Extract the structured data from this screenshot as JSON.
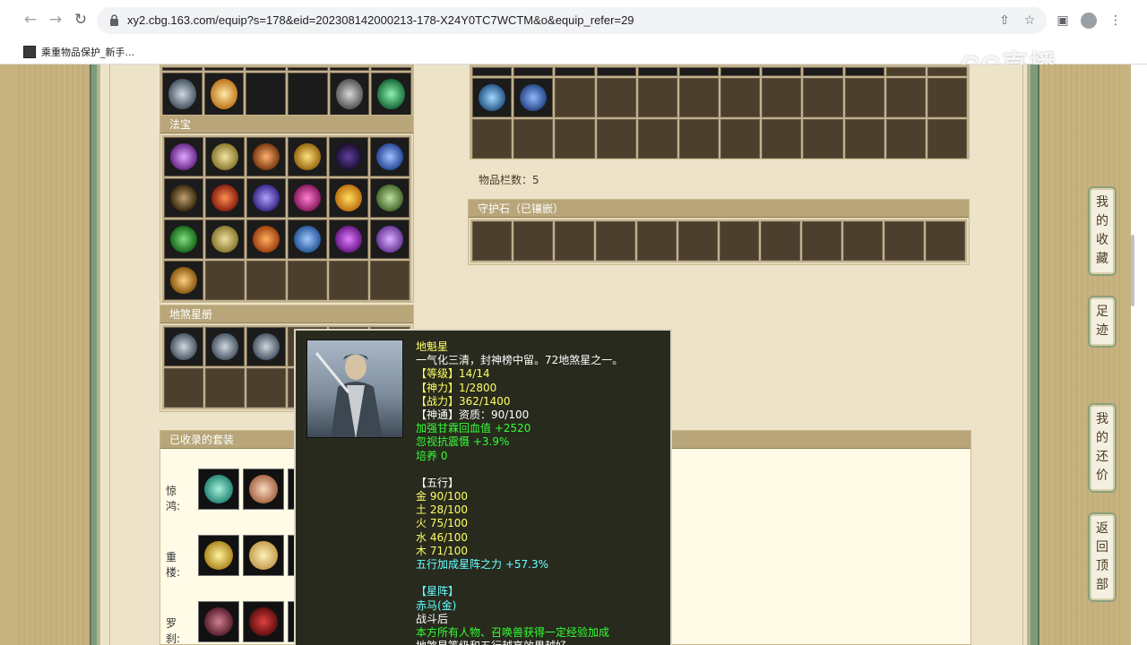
{
  "browser": {
    "url": "xy2.cbg.163.com/equip?s=178&eid=202308142000213-178-X24Y0TC7WCTM&o&equip_refer=29",
    "bookmark_label": "乘重物品保护_新手...",
    "watermark": "CC直播"
  },
  "sections": {
    "fabao_title": "法宝",
    "disha_title": "地煞星册",
    "guardian_title": "守护石（已镶嵌）",
    "item_count_label": "物品栏数：5",
    "suits_title": "已收录的套装"
  },
  "suits": [
    {
      "label": "惊鸿:"
    },
    {
      "label": "重楼:"
    },
    {
      "label": "罗刹:"
    }
  ],
  "side_buttons": {
    "favorites": "我的收藏",
    "footprint": "足迹",
    "bargain": "我的还价",
    "back_top": "返回顶部"
  },
  "tooltip": {
    "lines": [
      {
        "text": "地魁星",
        "color": "yellow"
      },
      {
        "text": "一气化三清，封神榜中留。72地煞星之一。",
        "color": "white"
      },
      {
        "text": "【等级】14/14",
        "color": "yellow"
      },
      {
        "text": "【神力】1/2800",
        "color": "yellow"
      },
      {
        "text": "【战力】362/1400",
        "color": "yellow"
      },
      {
        "text": "【神通】资质：90/100",
        "color": "white"
      },
      {
        "text": "加强甘霖回血值 +2520",
        "color": "green"
      },
      {
        "text": "忽视抗震慑 +3.9%",
        "color": "green"
      },
      {
        "text": "培养 0",
        "color": "green"
      },
      {
        "text": "",
        "color": "white"
      },
      {
        "text": "【五行】",
        "color": "white"
      },
      {
        "text": "金 90/100",
        "color": "yellow"
      },
      {
        "text": "土 28/100",
        "color": "yellow"
      },
      {
        "text": "火 75/100",
        "color": "yellow"
      },
      {
        "text": "水 46/100",
        "color": "yellow"
      },
      {
        "text": "木 71/100",
        "color": "yellow"
      },
      {
        "text": "五行加成星阵之力 +57.3%",
        "color": "cyan"
      },
      {
        "text": "",
        "color": "white"
      },
      {
        "text": "【星阵】",
        "color": "cyan"
      },
      {
        "text": "赤马(金)",
        "color": "cyan"
      },
      {
        "text": "战斗后",
        "color": "white"
      },
      {
        "text": "本方所有人物、召唤兽获得一定经验加成",
        "color": "green"
      },
      {
        "text": "地煞星等级和五行越高效果越好",
        "color": "white"
      }
    ]
  },
  "colors": {
    "frame": "#c7b380",
    "content": "#ede3c9",
    "slot": "#4c3f2e",
    "header": "#b8a67a",
    "tooltip_bg": "#282a1e"
  }
}
